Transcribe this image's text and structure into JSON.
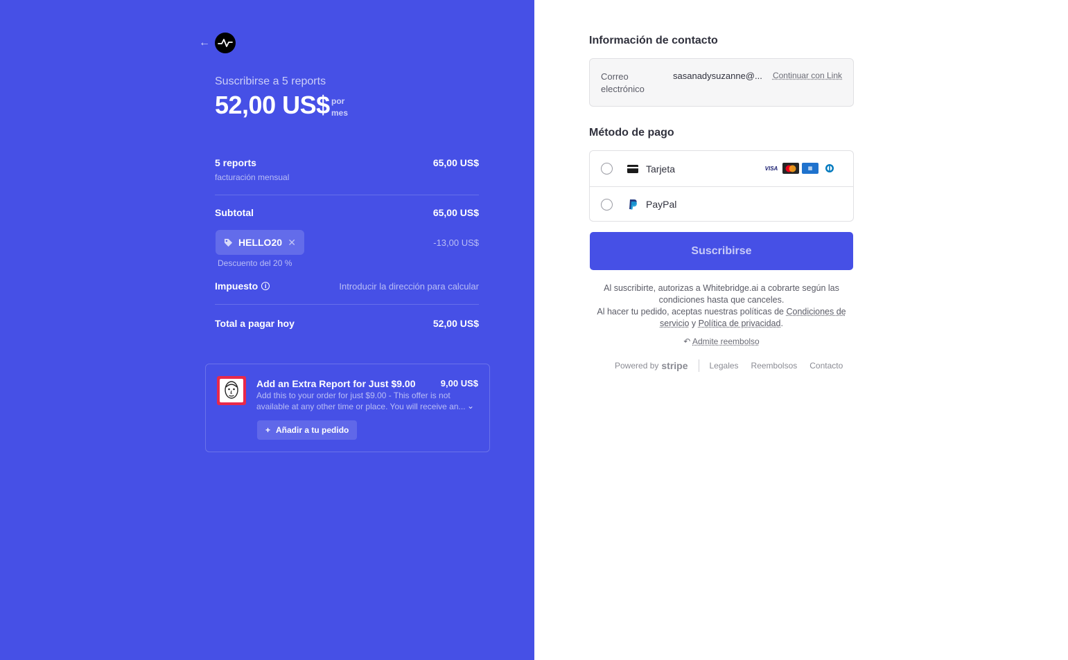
{
  "summary": {
    "subscribe_label": "Suscribirse a 5 reports",
    "price": "52,00 US$",
    "per_line1": "por",
    "per_line2": "mes",
    "item_name": "5 reports",
    "item_price": "65,00 US$",
    "item_billing": "facturación mensual",
    "subtotal_label": "Subtotal",
    "subtotal_value": "65,00 US$",
    "promo_code": "HELLO20",
    "discount_value": "-13,00 US$",
    "discount_hint": "Descuento del 20 %",
    "tax_label": "Impuesto",
    "tax_value": "Introducir la dirección para calcular",
    "total_label": "Total a pagar hoy",
    "total_value": "52,00 US$"
  },
  "upsell": {
    "title": "Add an Extra Report for Just $9.00",
    "price": "9,00 US$",
    "description": "Add this to your order for just $9.00 - This offer is not available at any other time or place. You will receive an...",
    "add_button": "Añadir a tu pedido",
    "add_prefix": "+"
  },
  "contact": {
    "heading": "Información de contacto",
    "email_label": "Correo electrónico",
    "email_value": "sasanadysuzanne@...",
    "link_button": "Continuar con Link"
  },
  "payment": {
    "heading": "Método de pago",
    "methods": [
      {
        "label": "Tarjeta",
        "icon": "card-icon"
      },
      {
        "label": "PayPal",
        "icon": "paypal-icon"
      }
    ],
    "brands": [
      "VISA",
      "mastercard",
      "amex",
      "diners"
    ]
  },
  "subscribe_button": "Suscribirse",
  "legal": {
    "line1": "Al suscribirte, autorizas a Whitebridge.ai a cobrarte según las condiciones hasta que canceles.",
    "line2_prefix": "Al hacer tu pedido, aceptas nuestras políticas de",
    "terms_link": "Condiciones de servicio",
    "and": "y",
    "privacy_link": "Política de privacidad",
    "refund_link": "Admite reembolso"
  },
  "footer": {
    "powered_by": "Powered by",
    "brand": "stripe",
    "links": [
      "Legales",
      "Reembolsos",
      "Contacto"
    ]
  },
  "colors": {
    "brand_blue": "#4650e6",
    "upsell_image_red": "#e8294b"
  }
}
